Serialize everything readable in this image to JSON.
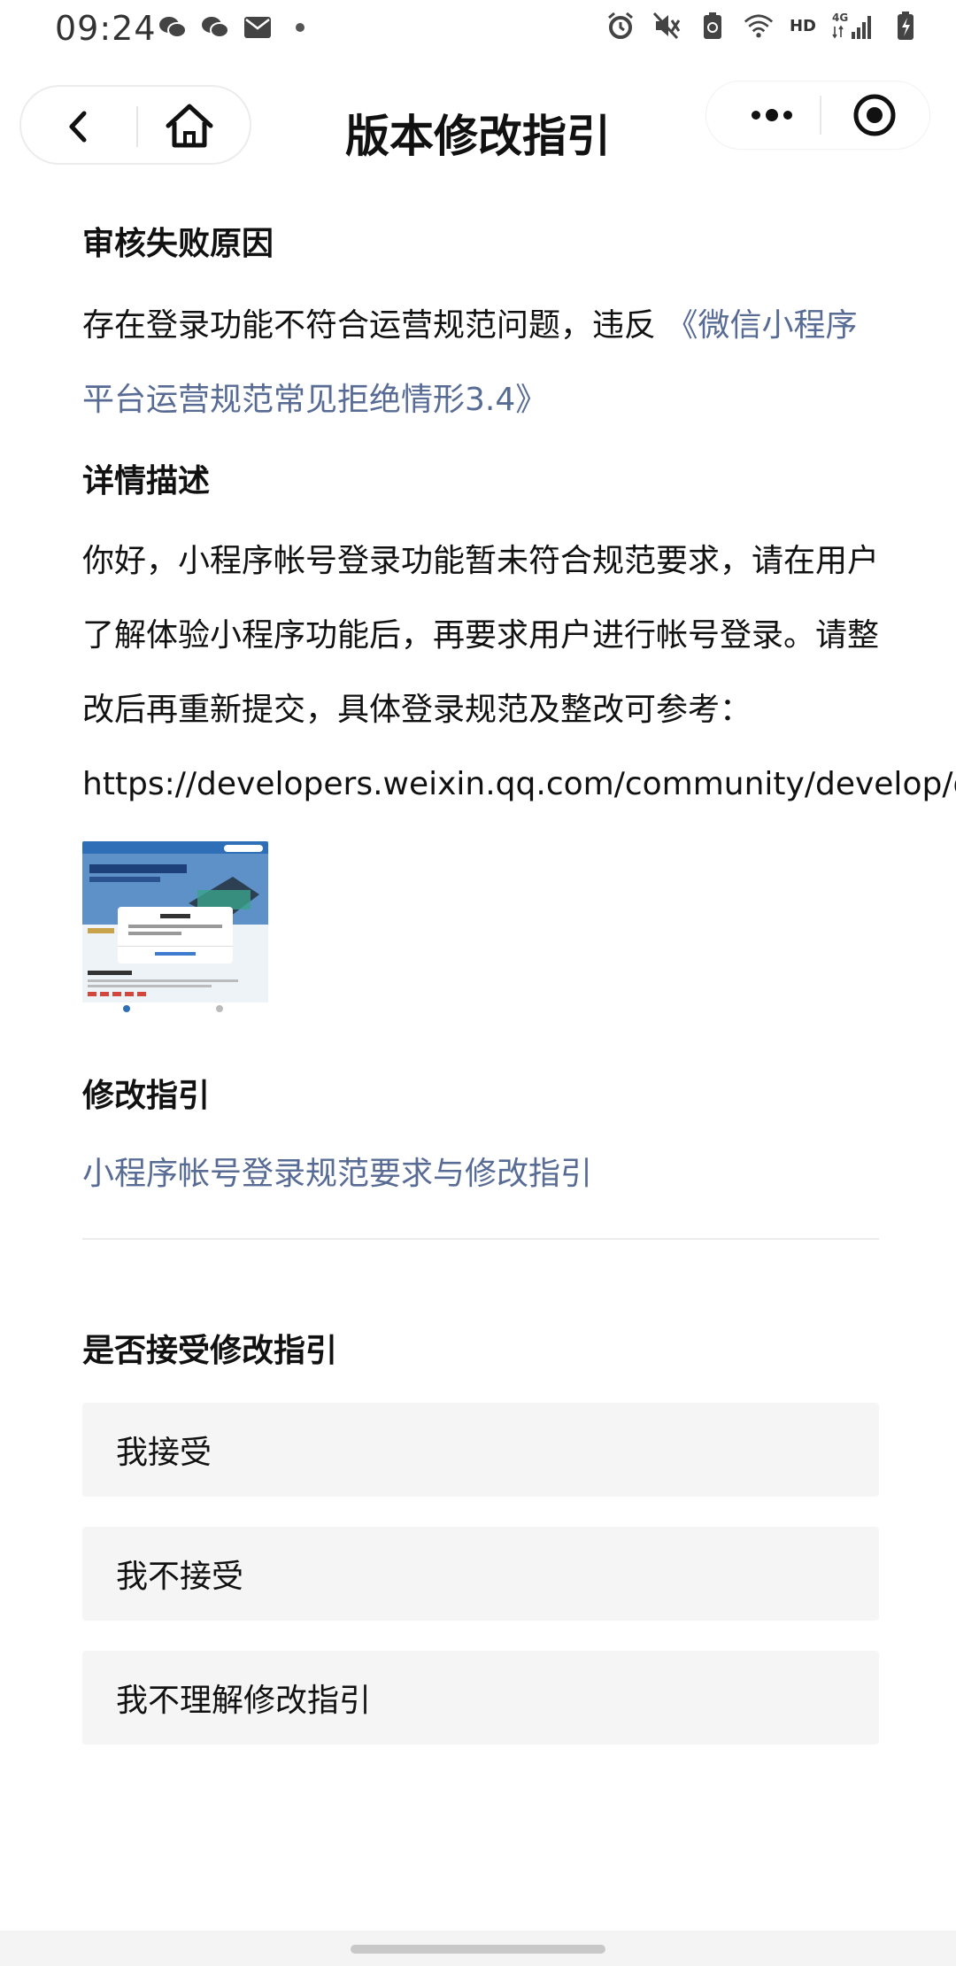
{
  "status_bar": {
    "time": "09:24",
    "left_icons": [
      "wechat-icon",
      "wechat-icon",
      "mail-icon",
      "dot-icon"
    ],
    "right_icons": [
      "alarm-icon",
      "mute-icon",
      "battery-saver-icon",
      "wifi-icon",
      "hd-icon",
      "signal-4g-icon",
      "battery-icon"
    ],
    "hd_label": "HD",
    "net_label": "4G"
  },
  "navbar": {
    "title": "版本修改指引"
  },
  "reason": {
    "title": "审核失败原因",
    "text": "存在登录功能不符合运营规范问题，违反",
    "link": "《微信小程序平台运营规范常见拒绝情形3.4》"
  },
  "details": {
    "title": "详情描述",
    "text": "你好，小程序帐号登录功能暂未符合规范要求，请在用户了解体验小程序功能后，再要求用户进行帐号登录。请整改后再重新提交，具体登录规范及整改可参考：",
    "url": "https://developers.weixin.qq.com/community/develop/d"
  },
  "guide": {
    "title": "修改指引",
    "link": "小程序帐号登录规范要求与修改指引"
  },
  "accept": {
    "title": "是否接受修改指引",
    "options": [
      "我接受",
      "我不接受",
      "我不理解修改指引"
    ]
  },
  "colors": {
    "link": "#576b95",
    "option_bg": "#f5f5f5"
  }
}
